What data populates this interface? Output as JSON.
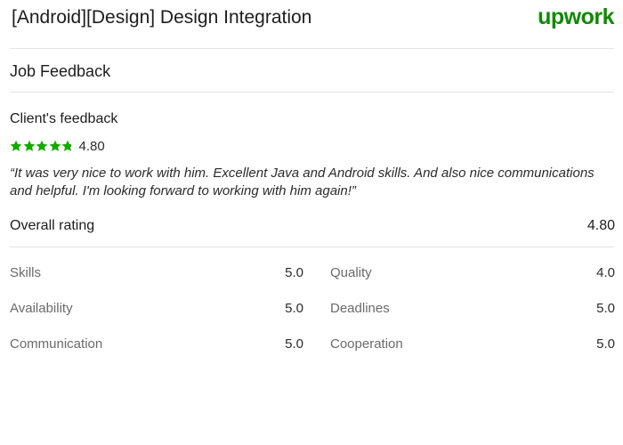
{
  "header": {
    "title": "[Android][Design] Design Integration",
    "logo_text": "upwork",
    "brand_color": "#108a00"
  },
  "section": {
    "title": "Job Feedback"
  },
  "client_feedback": {
    "heading": "Client's feedback",
    "star_rating": 4.8,
    "score_label": "4.80",
    "comment": "“It was very nice to work with him. Excellent Java and Android skills. And also nice communications and helpful. I'm looking forward to working with him again!”",
    "star_color": "#14a800"
  },
  "overall": {
    "label": "Overall rating",
    "value": "4.80"
  },
  "metrics": {
    "left": [
      {
        "label": "Skills",
        "value": "5.0"
      },
      {
        "label": "Availability",
        "value": "5.0"
      },
      {
        "label": "Communication",
        "value": "5.0"
      }
    ],
    "right": [
      {
        "label": "Quality",
        "value": "4.0"
      },
      {
        "label": "Deadlines",
        "value": "5.0"
      },
      {
        "label": "Cooperation",
        "value": "5.0"
      }
    ]
  }
}
